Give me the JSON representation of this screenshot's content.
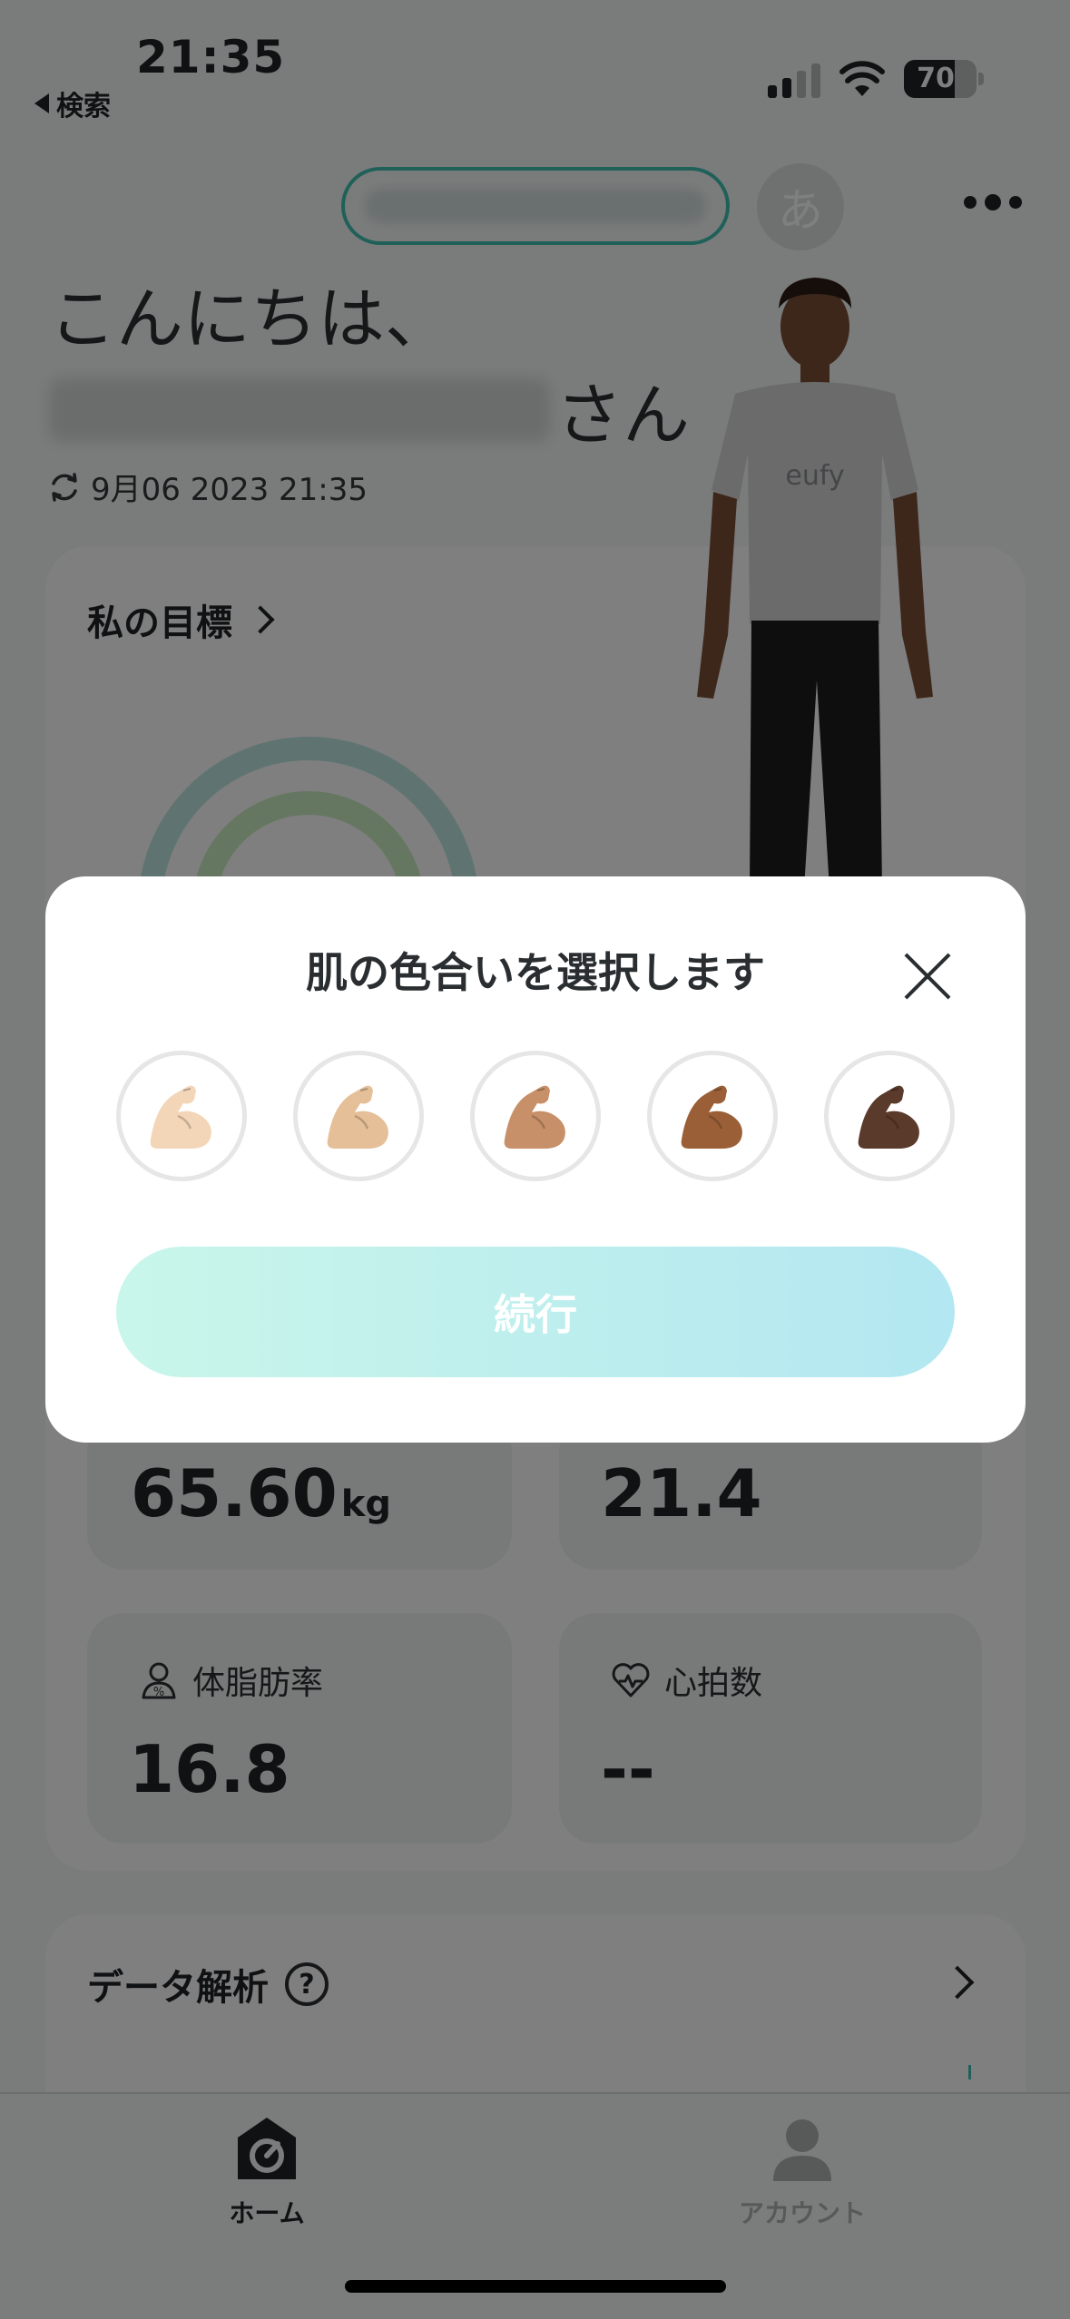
{
  "status_bar": {
    "time": "21:35",
    "back_label": "検索",
    "battery_level": "70"
  },
  "header": {
    "avatar_initial": "あ"
  },
  "greeting": {
    "line1": "こんにちは、",
    "suffix": "さん"
  },
  "sync": {
    "timestamp": "9月06 2023 21:35"
  },
  "goal": {
    "title": "私の目標"
  },
  "avatar_model": {
    "shirt_brand": "eufy"
  },
  "metrics": {
    "weight": {
      "value": "65.60",
      "unit": "kg"
    },
    "bmi": {
      "value": "21.4"
    },
    "body_fat": {
      "label": "体脂肪率",
      "value": "16.8"
    },
    "heart_rate": {
      "label": "心拍数",
      "value": "--"
    }
  },
  "analysis": {
    "title": "データ解析",
    "help_symbol": "?"
  },
  "tabs": {
    "home": "ホーム",
    "account": "アカウント"
  },
  "modal": {
    "title": "肌の色合いを選択します",
    "continue_label": "続行",
    "skin_tones": [
      "#f3d6b8",
      "#e5bf98",
      "#c79068",
      "#9a5f36",
      "#5a3a2b"
    ]
  },
  "colors": {
    "accent": "#3ec3b2",
    "button_gradient_start": "#c9f6ea",
    "button_gradient_end": "#b3e7f1"
  }
}
